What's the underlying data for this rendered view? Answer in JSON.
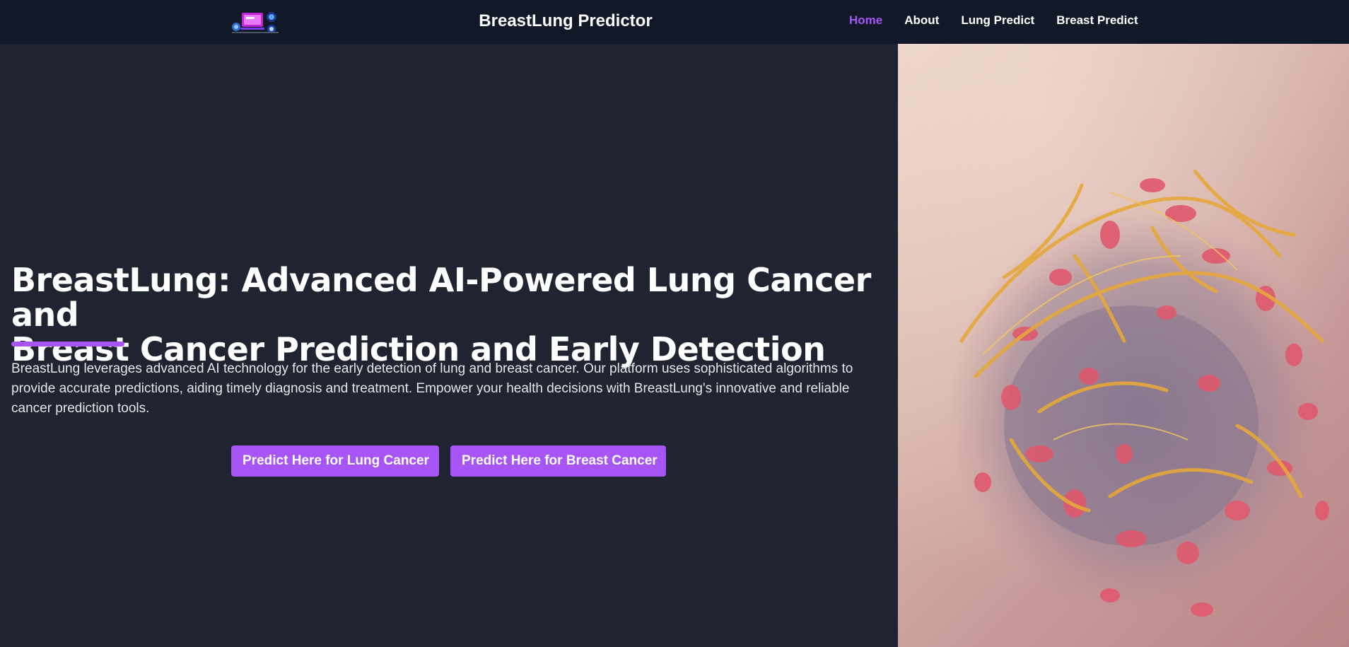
{
  "header": {
    "brand": "BreastLung Predictor",
    "logo_icon": "devices-illustration-icon",
    "nav": [
      {
        "label": "Home",
        "active": true
      },
      {
        "label": "About",
        "active": false
      },
      {
        "label": "Lung Predict",
        "active": false
      },
      {
        "label": "Breast Predict",
        "active": false
      }
    ]
  },
  "hero": {
    "title_line1": "BreastLung: Advanced AI-Powered Lung Cancer and",
    "title_line2": "Breast Cancer Prediction and Early Detection",
    "description": "BreastLung leverages advanced AI technology for the early detection of lung and breast cancer. Our platform uses sophisticated algorithms to provide accurate predictions, aiding timely diagnosis and treatment. Empower your health decisions with BreastLung's innovative and reliable cancer prediction tools.",
    "btn_lung": "Predict Here for Lung Cancer",
    "btn_breast": "Predict Here for Breast Cancer"
  },
  "image": {
    "subject": "cancer-cell-3d-illustration"
  },
  "colors": {
    "accent": "#a855f7",
    "navbar_bg": "#111827",
    "page_bg": "#1f2430"
  }
}
